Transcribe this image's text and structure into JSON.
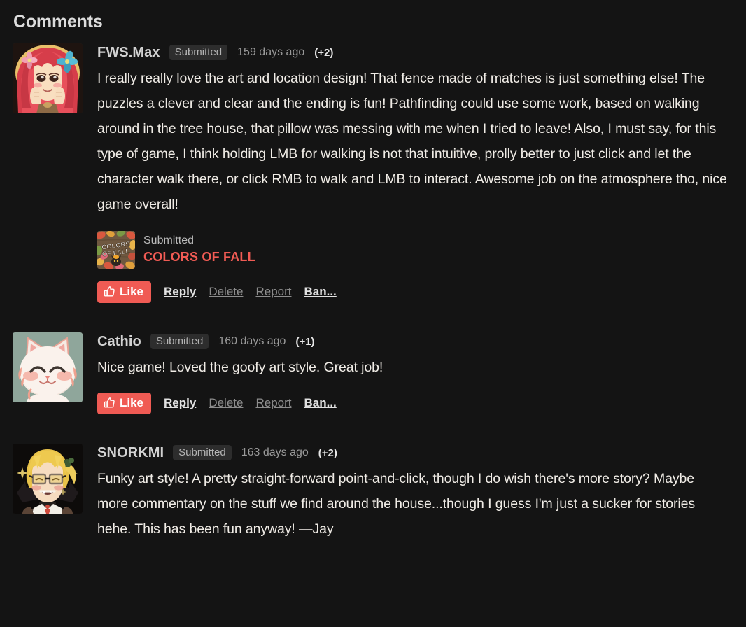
{
  "page": {
    "heading": "Comments",
    "background_color": "#141414",
    "accent_color": "#f05b54"
  },
  "actions": {
    "like_label": "Like",
    "reply_label": "Reply",
    "delete_label": "Delete",
    "report_label": "Report",
    "ban_label": "Ban...",
    "like_icon": "thumbs-up-icon"
  },
  "comments": [
    {
      "author": "FWS.Max",
      "badge": "Submitted",
      "timestamp": "159 days ago",
      "votes": "(+2)",
      "avatar_name": "avatar-fws-max",
      "text": "I really really love the art and location design! That fence made of matches is just something else! The puzzles a clever and clear and the ending is fun! Pathfinding could use some work, based on walking around in the tree house, that pillow was messing with me when I tried to leave! Also, I must say, for this type of game, I think holding LMB for walking is not that intuitive, prolly better to just click and let the character walk there, or click RMB to walk and LMB to interact. Awesome job on the atmosphere tho, nice game overall!",
      "game_ref": {
        "submitted_label": "Submitted",
        "title": "COLORS OF FALL",
        "thumb_text_line1": "COLORS",
        "thumb_text_line2": "OF FALL"
      }
    },
    {
      "author": "Cathio",
      "badge": "Submitted",
      "timestamp": "160 days ago",
      "votes": "(+1)",
      "avatar_name": "avatar-cathio",
      "text": "Nice game! Loved the goofy art style. Great job!",
      "game_ref": null
    },
    {
      "author": "SNORKMI",
      "badge": "Submitted",
      "timestamp": "163 days ago",
      "votes": "(+2)",
      "avatar_name": "avatar-snorkmi",
      "text": "Funky art style! A pretty straight-forward point-and-click, though I do wish there's more story? Maybe more commentary on the stuff we find around the house...though I guess I'm just a sucker for stories hehe. This has been fun anyway! —Jay",
      "game_ref": null
    }
  ]
}
